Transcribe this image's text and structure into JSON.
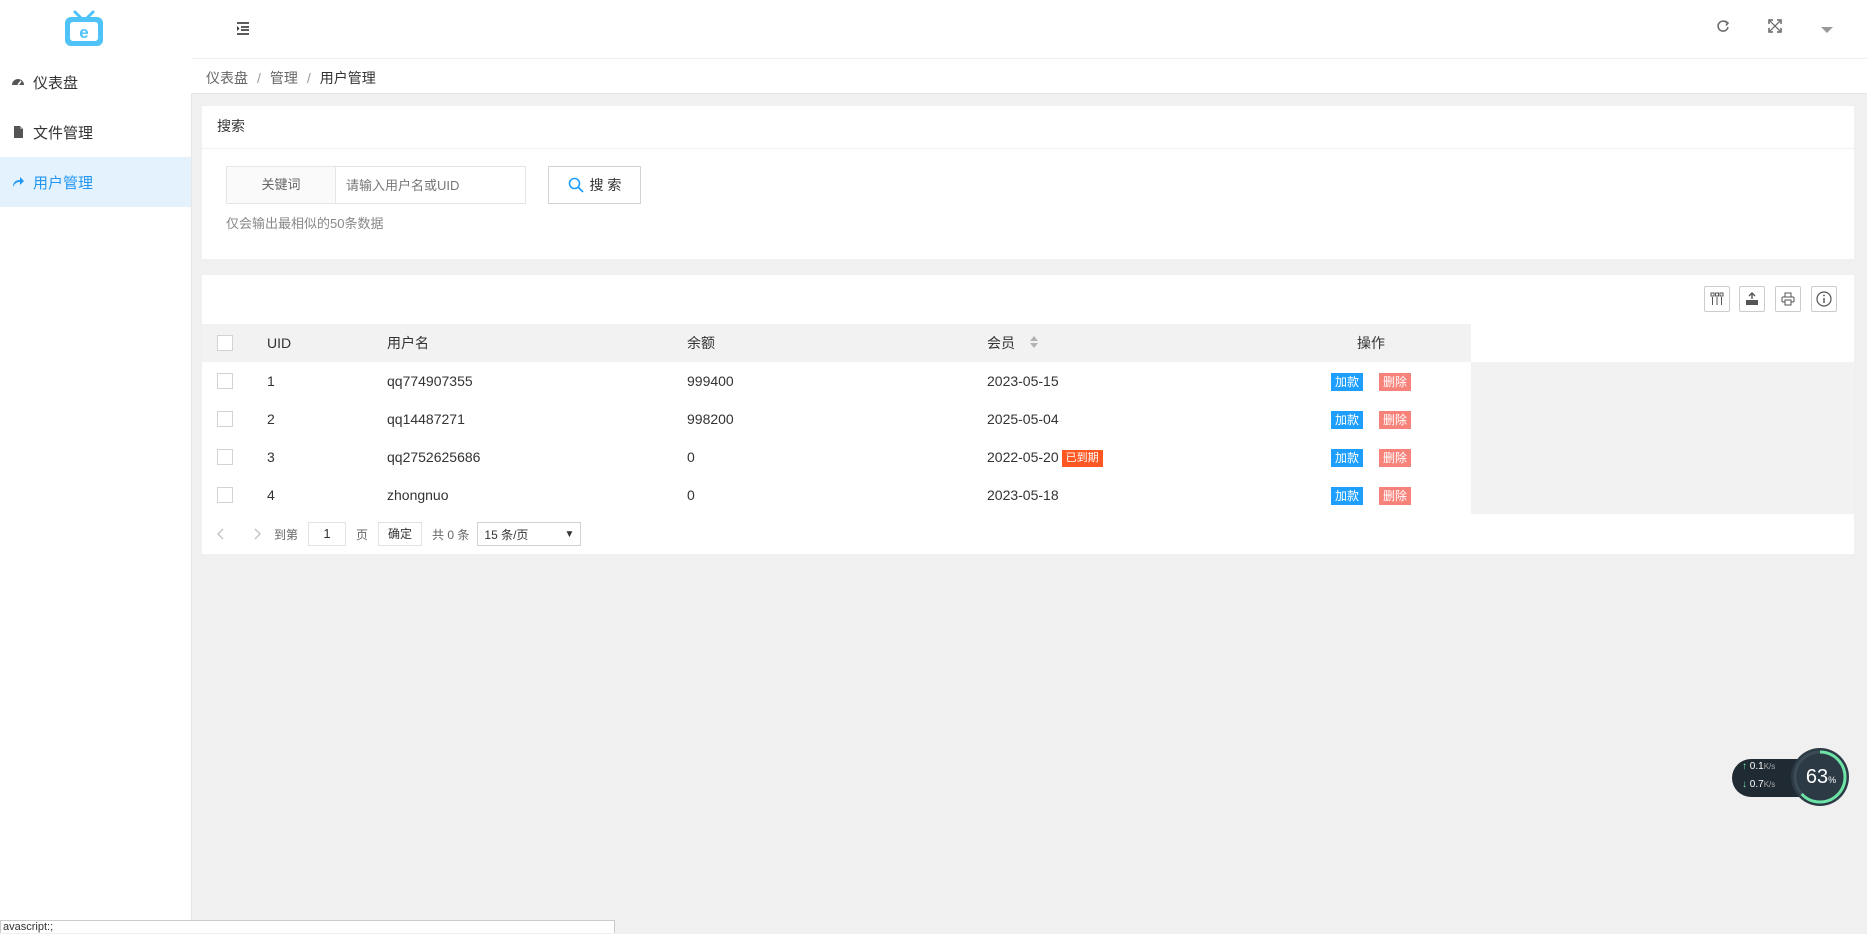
{
  "sidebar": {
    "items": [
      {
        "label": "仪表盘",
        "icon": "dashboard-icon",
        "active": false
      },
      {
        "label": "文件管理",
        "icon": "file-icon",
        "active": false
      },
      {
        "label": "用户管理",
        "icon": "share-icon",
        "active": true
      }
    ]
  },
  "breadcrumb": {
    "items": [
      "仪表盘",
      "管理",
      "用户管理"
    ]
  },
  "search": {
    "card_title": "搜索",
    "keyword_label": "关键词",
    "placeholder": "请输入用户名或UID",
    "value": "",
    "button_label": "搜 索",
    "hint": "仅会输出最相似的50条数据"
  },
  "table": {
    "columns": [
      "UID",
      "用户名",
      "余额",
      "会员",
      "操作"
    ],
    "rows": [
      {
        "uid": "1",
        "username": "qq774907355",
        "balance": "999400",
        "member": "2023-05-15",
        "badge": ""
      },
      {
        "uid": "2",
        "username": "qq14487271",
        "balance": "998200",
        "member": "2025-05-04",
        "badge": ""
      },
      {
        "uid": "3",
        "username": "qq2752625686",
        "balance": "0",
        "member": "2022-05-20",
        "badge": "已到期"
      },
      {
        "uid": "4",
        "username": "zhongnuo",
        "balance": "0",
        "member": "2023-05-18",
        "badge": ""
      }
    ],
    "add_label": "加款",
    "delete_label": "删除"
  },
  "pager": {
    "goto_label": "到第",
    "page_value": "1",
    "page_unit": "页",
    "confirm_label": "确定",
    "total_label": "共 0 条",
    "page_size": "15 条/页"
  },
  "net_widget": {
    "upload_value": "0.1",
    "upload_unit": "K/s",
    "download_value": "0.7",
    "download_unit": "K/s",
    "percent": "63",
    "percent_unit": "%"
  },
  "statusbar": {
    "text": "avascript:;"
  },
  "colors": {
    "accent": "#2196f3",
    "add_button": "#1e9fff",
    "delete_button": "#f7827a",
    "expired_badge": "#ff5722"
  }
}
